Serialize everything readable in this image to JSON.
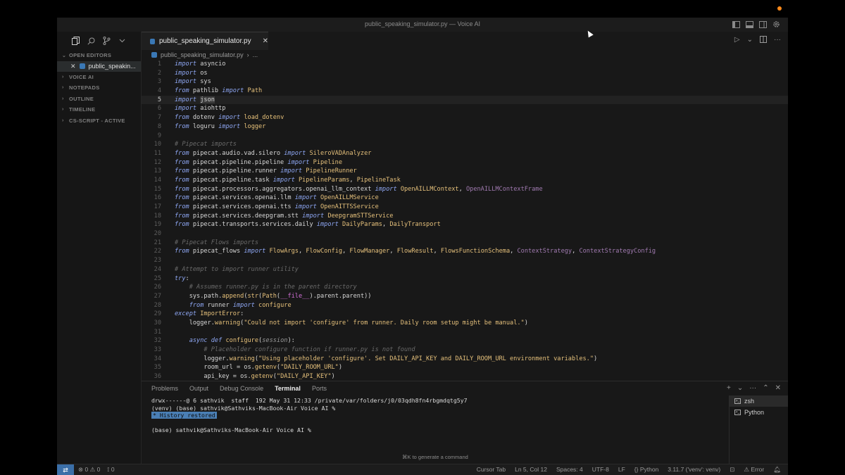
{
  "window_title": "public_speaking_simulator.py — Voice AI",
  "sidebar": {
    "sections": {
      "open_editors": "OPEN EDITORS",
      "voice_ai": "VOICE AI",
      "notepads": "NOTEPADS",
      "outline": "OUTLINE",
      "timeline": "TIMELINE",
      "cs_script": "CS-SCRIPT - ACTIVE"
    },
    "open_file": "public_speakin..."
  },
  "editor": {
    "tab_label": "public_speaking_simulator.py",
    "breadcrumb_file": "public_speaking_simulator.py",
    "breadcrumb_more": "...",
    "active_line": 5
  },
  "code_lines": [
    "1",
    "2",
    "3",
    "4",
    "5",
    "6",
    "7",
    "8",
    "9",
    "10",
    "11",
    "12",
    "13",
    "14",
    "15",
    "16",
    "17",
    "18",
    "19",
    "20",
    "21",
    "22",
    "23",
    "24",
    "25",
    "26",
    "27",
    "28",
    "29",
    "30",
    "31",
    "32",
    "33",
    "34",
    "35",
    "36"
  ],
  "panel": {
    "tabs": [
      "Problems",
      "Output",
      "Debug Console",
      "Terminal",
      "Ports"
    ],
    "active_tab": "Terminal",
    "terminal_lines": {
      "l1": "drwx------@ 6 sathvik  staff  192 May 31 12:33 /private/var/folders/j0/03qdh8fn4rbgmdqtg5y7",
      "l2": "(venv) (base) sathvik@Sathviks-MacBook-Air Voice AI %",
      "l3_badge": "History restored",
      "l4": "(base) sathvik@Sathviks-MacBook-Air Voice AI %"
    },
    "terminals": [
      "zsh",
      "Python"
    ],
    "cmd_hint": "⌘K to generate a command"
  },
  "statusbar": {
    "errors": "0",
    "warnings": "0",
    "ports": "0",
    "cursor_tab": "Cursor Tab",
    "position": "Ln 5, Col 12",
    "spaces": "Spaces: 4",
    "encoding": "UTF-8",
    "eol": "LF",
    "language": "Python",
    "interpreter": "3.11.7 ('venv': venv)",
    "error_label": "Error"
  }
}
